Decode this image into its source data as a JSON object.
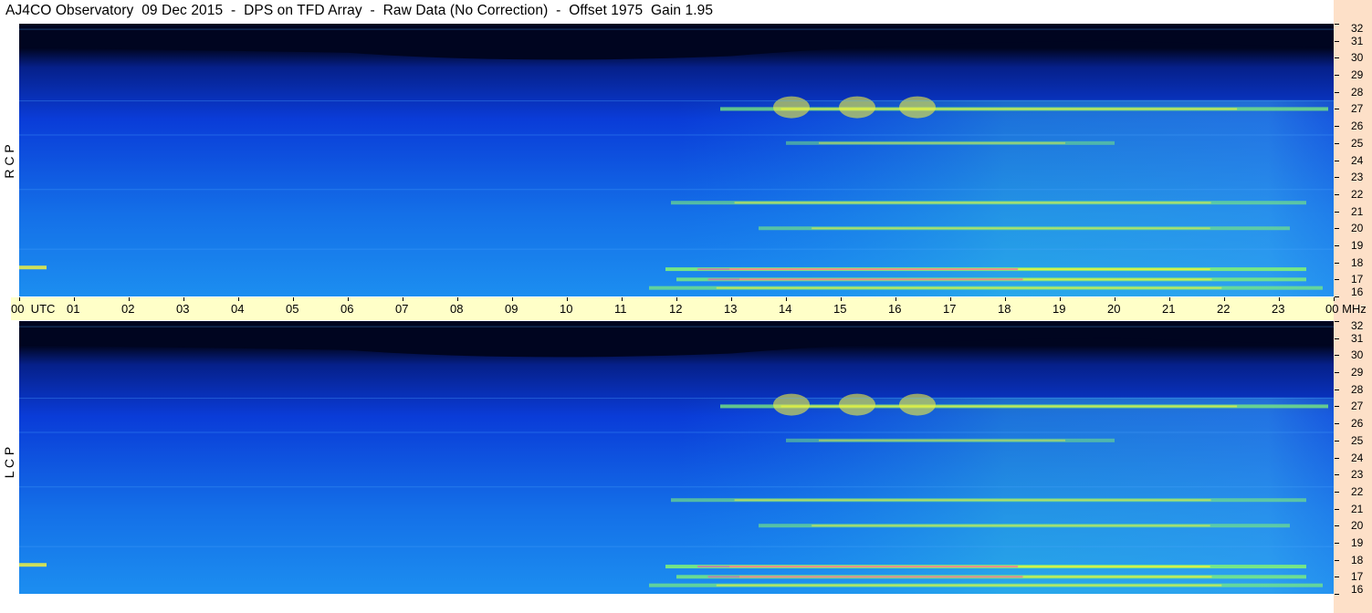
{
  "header": {
    "title": "AJ4CO Observatory  09 Dec 2015  -  DPS on TFD Array  -  Raw Data (No Correction)  -  Offset 1975  Gain 1.95"
  },
  "panels": {
    "top_label": "R C P",
    "bottom_label": "L C P"
  },
  "utc_axis": {
    "labels": [
      "00  UTC",
      "01",
      "02",
      "03",
      "04",
      "05",
      "06",
      "07",
      "08",
      "09",
      "10",
      "11",
      "12",
      "13",
      "14",
      "15",
      "16",
      "17",
      "18",
      "19",
      "20",
      "21",
      "22",
      "23",
      "00 MHz"
    ]
  },
  "mhz_axis": {
    "labels": [
      "32",
      "31",
      "30",
      "29",
      "28",
      "27",
      "26",
      "25",
      "24",
      "23",
      "22",
      "21",
      "20",
      "19",
      "18",
      "17",
      "16"
    ]
  },
  "colors": {
    "deep": "#000520",
    "mid_blue": "#0a3cd8",
    "cyan_blue": "#1c8ef0",
    "band_green": "#7ef07a",
    "band_yellow": "#f0f040",
    "band_magenta": "#ff40c0",
    "utc_band": "#ffffc8",
    "right_strip": "#fde0c8"
  },
  "chart_data": [
    {
      "type": "heatmap",
      "name": "RCP",
      "title": "R C P",
      "x_range": [
        0,
        24
      ],
      "y_range": [
        16,
        32
      ],
      "x_unit": "UTC hours",
      "y_unit": "MHz",
      "features": [
        {
          "kind": "band",
          "freq": 27.0,
          "start": 12.8,
          "end": 23.9,
          "strength": 0.75
        },
        {
          "kind": "band",
          "freq": 17.6,
          "start": 11.8,
          "end": 23.5,
          "strength": 0.9
        },
        {
          "kind": "band",
          "freq": 17.0,
          "start": 12.0,
          "end": 23.5,
          "strength": 0.8
        },
        {
          "kind": "band",
          "freq": 21.5,
          "start": 11.9,
          "end": 23.5,
          "strength": 0.6
        },
        {
          "kind": "band",
          "freq": 20.0,
          "start": 13.5,
          "end": 23.2,
          "strength": 0.6
        },
        {
          "kind": "band",
          "freq": 25.0,
          "start": 14.0,
          "end": 20.0,
          "strength": 0.5
        },
        {
          "kind": "band",
          "freq": 16.5,
          "start": 11.5,
          "end": 23.8,
          "strength": 0.7
        }
      ]
    },
    {
      "type": "heatmap",
      "name": "LCP",
      "title": "L C P",
      "x_range": [
        0,
        24
      ],
      "y_range": [
        16,
        32
      ],
      "x_unit": "UTC hours",
      "y_unit": "MHz",
      "features": [
        {
          "kind": "band",
          "freq": 27.0,
          "start": 12.8,
          "end": 23.9,
          "strength": 0.75
        },
        {
          "kind": "band",
          "freq": 17.6,
          "start": 11.8,
          "end": 23.5,
          "strength": 0.9
        },
        {
          "kind": "band",
          "freq": 17.0,
          "start": 12.0,
          "end": 23.5,
          "strength": 0.8
        },
        {
          "kind": "band",
          "freq": 21.5,
          "start": 11.9,
          "end": 23.5,
          "strength": 0.6
        },
        {
          "kind": "band",
          "freq": 20.0,
          "start": 13.5,
          "end": 23.2,
          "strength": 0.6
        },
        {
          "kind": "band",
          "freq": 25.0,
          "start": 14.0,
          "end": 20.0,
          "strength": 0.5
        },
        {
          "kind": "band",
          "freq": 16.5,
          "start": 11.5,
          "end": 23.8,
          "strength": 0.7
        }
      ]
    }
  ]
}
